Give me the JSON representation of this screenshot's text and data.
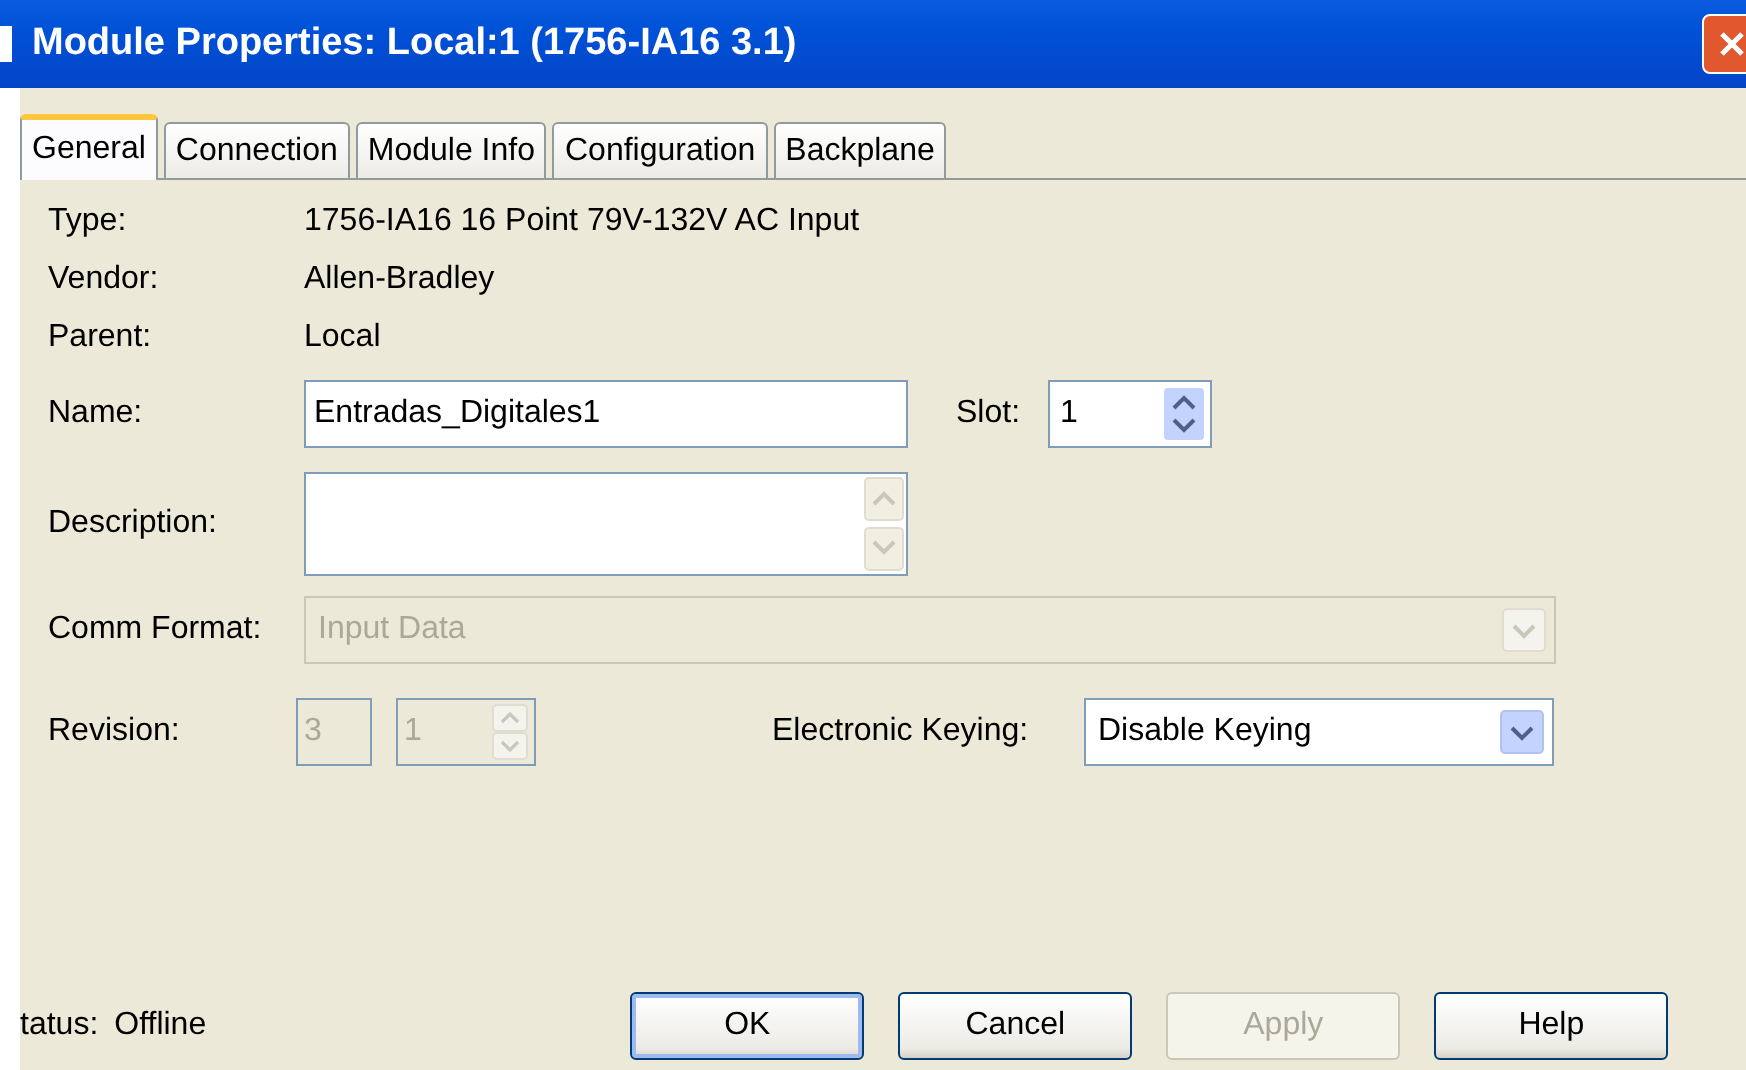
{
  "window": {
    "title": "Module Properties: Local:1 (1756-IA16 3.1)"
  },
  "tabs": [
    {
      "label": "General",
      "selected": true
    },
    {
      "label": "Connection",
      "selected": false
    },
    {
      "label": "Module Info",
      "selected": false
    },
    {
      "label": "Configuration",
      "selected": false
    },
    {
      "label": "Backplane",
      "selected": false
    }
  ],
  "info": [
    {
      "label": "Type:",
      "value": "1756-IA16 16 Point 79V-132V AC Input"
    },
    {
      "label": "Vendor:",
      "value": "Allen-Bradley"
    },
    {
      "label": "Parent:",
      "value": "Local"
    }
  ],
  "name": {
    "label": "Name:",
    "value": "Entradas_Digitales1"
  },
  "slot": {
    "label": "Slot:",
    "value": "1"
  },
  "description": {
    "label": "Description:"
  },
  "comm_format": {
    "label": "Comm Format:",
    "value": "Input Data",
    "disabled": true
  },
  "revision": {
    "label": "Revision:",
    "major": "3",
    "minor": "1",
    "disabled": true
  },
  "electronic_keying": {
    "label": "Electronic Keying:",
    "value": "Disable Keying",
    "disabled": false
  },
  "status": {
    "label": "tatus:",
    "value": "Offline"
  },
  "buttons": [
    {
      "label": "OK",
      "default": true,
      "disabled": false
    },
    {
      "label": "Cancel",
      "default": false,
      "disabled": false
    },
    {
      "label": "Apply",
      "default": false,
      "disabled": true
    },
    {
      "label": "Help",
      "default": false,
      "disabled": false
    }
  ]
}
